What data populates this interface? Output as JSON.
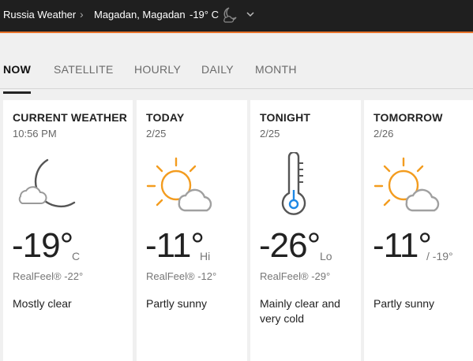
{
  "header": {
    "region": "Russia Weather",
    "location": "Magadan, Magadan",
    "temp": "-19° C",
    "weather_icon": "moon-cloud-icon"
  },
  "tabs": [
    "NOW",
    "SATELLITE",
    "HOURLY",
    "DAILY",
    "MONTH"
  ],
  "active_tab": "NOW",
  "cards": [
    {
      "title": "CURRENT WEATHER",
      "sub": "10:56 PM",
      "icon": "moon-cloud-icon",
      "temp": "-19°",
      "unit": "C",
      "realfeel": "RealFeel® -22°",
      "phrase": "Mostly clear"
    },
    {
      "title": "TODAY",
      "sub": "2/25",
      "icon": "partly-sunny-icon",
      "temp": "-11°",
      "unit": "Hi",
      "realfeel": "RealFeel® -12°",
      "phrase": "Partly sunny"
    },
    {
      "title": "TONIGHT",
      "sub": "2/25",
      "icon": "thermometer-cold-icon",
      "temp": "-26°",
      "unit": "Lo",
      "realfeel": "RealFeel® -29°",
      "phrase": "Mainly clear and very cold"
    },
    {
      "title": "TOMORROW",
      "sub": "2/26",
      "icon": "partly-sunny-icon",
      "temp": "-11°",
      "unit": "/ -19°",
      "realfeel": "",
      "phrase": "Partly sunny"
    }
  ],
  "colors": {
    "topbar": "#1f1f1f",
    "accent": "#e8742b",
    "sun": "#f39c1f",
    "cold": "#1e88e5"
  }
}
